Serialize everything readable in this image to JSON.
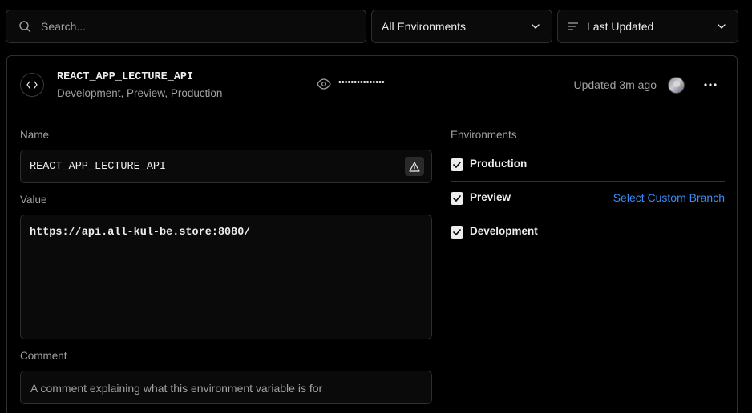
{
  "search": {
    "placeholder": "Search..."
  },
  "filters": {
    "environment": "All Environments",
    "sort": "Last Updated"
  },
  "variable": {
    "name": "REACT_APP_LECTURE_API",
    "environments_summary": "Development, Preview, Production",
    "masked_value": "•••••••••••••••",
    "updated": "Updated 3m ago"
  },
  "form": {
    "name_label": "Name",
    "name_value": "REACT_APP_LECTURE_API",
    "value_label": "Value",
    "value_value": "https://api.all-kul-be.store:8080/",
    "comment_label": "Comment",
    "comment_placeholder": "A comment explaining what this environment variable is for"
  },
  "environments": {
    "title": "Environments",
    "items": [
      {
        "label": "Production",
        "checked": true
      },
      {
        "label": "Preview",
        "checked": true,
        "action": "Select Custom Branch"
      },
      {
        "label": "Development",
        "checked": true
      }
    ]
  },
  "colors": {
    "background": "#000000",
    "border": "#2e2e2e",
    "muted_text": "#a1a1a1",
    "link": "#3b8bf6"
  }
}
